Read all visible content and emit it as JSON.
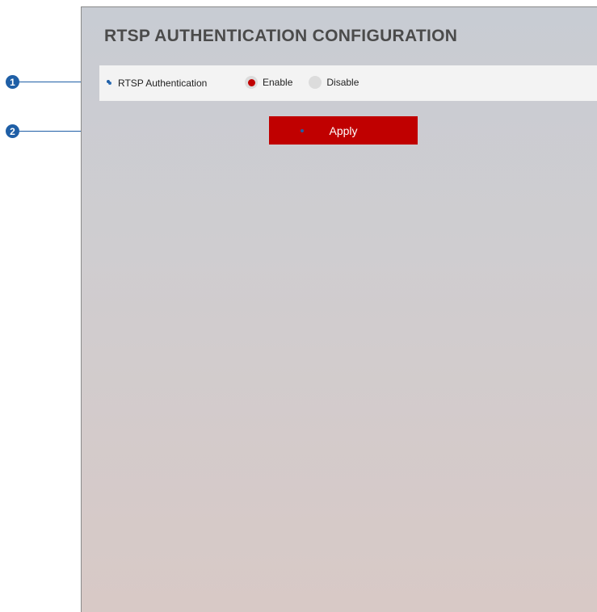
{
  "panel": {
    "title": "RTSP AUTHENTICATION CONFIGURATION"
  },
  "setting": {
    "label": "RTSP Authentication",
    "options": [
      {
        "label": "Enable",
        "checked": true
      },
      {
        "label": "Disable",
        "checked": false
      }
    ]
  },
  "actions": {
    "apply_label": "Apply"
  },
  "callouts": [
    "1",
    "2"
  ],
  "colors": {
    "accent": "#c00000",
    "callout": "#1f5fa6",
    "title": "#4b4b4b"
  }
}
